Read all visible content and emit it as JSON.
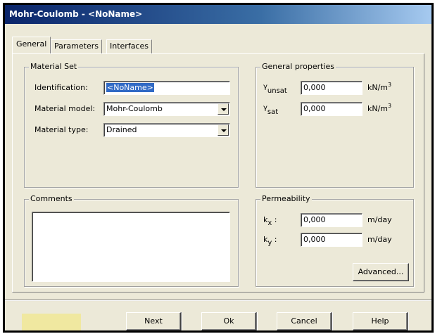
{
  "window": {
    "title": "Mohr-Coulomb - <NoName>"
  },
  "tabs": [
    {
      "label": "General",
      "active": true
    },
    {
      "label": "Parameters",
      "active": false
    },
    {
      "label": "Interfaces",
      "active": false
    }
  ],
  "material_set": {
    "group_title": "Material Set",
    "identification_label": "Identification:",
    "identification_value": "<NoName>",
    "model_label": "Material model:",
    "model_value": "Mohr-Coulomb",
    "type_label": "Material type:",
    "type_value": "Drained"
  },
  "general_properties": {
    "group_title": "General properties",
    "gamma_symbol": "γ",
    "gamma_unsat_sub": "unsat",
    "gamma_unsat_value": "0,000",
    "gamma_sat_sub": "sat",
    "gamma_sat_value": "0,000",
    "unit_base": "kN/m",
    "unit_exp": "3"
  },
  "comments": {
    "group_title": "Comments",
    "value": ""
  },
  "permeability": {
    "group_title": "Permeability",
    "k_letter": "k",
    "kx_sub": "x",
    "ky_sub": "y",
    "colon": ":",
    "kx_value": "0,000",
    "ky_value": "0,000",
    "unit": "m/day",
    "advanced_label": "Advanced..."
  },
  "footer": {
    "next_label": "Next",
    "ok_label": "Ok",
    "cancel_label": "Cancel",
    "help_label": "Help"
  },
  "colors": {
    "titlebar_start": "#0a246a",
    "face": "#ece9d8",
    "selection": "#316ac5",
    "status_yellow": "#f0e8a0"
  }
}
